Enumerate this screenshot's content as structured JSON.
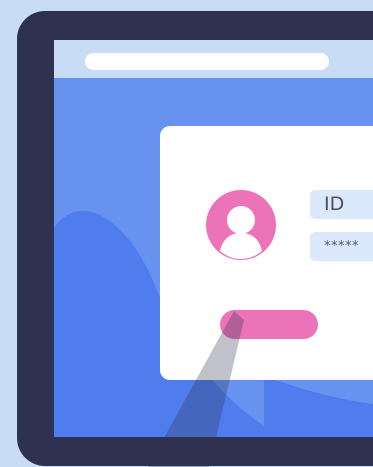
{
  "login_form": {
    "id_field_value": "ID",
    "password_field_value": "*****"
  },
  "icons": {
    "avatar": "user-avatar-icon"
  },
  "colors": {
    "background": "#c9dcf6",
    "device_frame": "#2f3150",
    "screen": "#6792f0",
    "card": "#ffffff",
    "accent": "#ec73b8",
    "input_fill": "#dce8fb"
  }
}
